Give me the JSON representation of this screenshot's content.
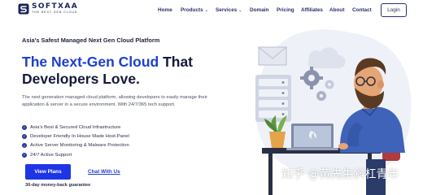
{
  "brand": {
    "name": "SOFTXAA",
    "tagline": "THE NEXT GEN CLOUD",
    "color": "#1b2456"
  },
  "nav": {
    "items": [
      {
        "label": "Home",
        "dropdown": false
      },
      {
        "label": "Products",
        "dropdown": true
      },
      {
        "label": "Services",
        "dropdown": true
      },
      {
        "label": "Domain",
        "dropdown": false
      },
      {
        "label": "Pricing",
        "dropdown": false
      },
      {
        "label": "Affiliates",
        "dropdown": false
      },
      {
        "label": "About",
        "dropdown": false
      },
      {
        "label": "Contact",
        "dropdown": false
      }
    ],
    "login_label": "Login"
  },
  "hero": {
    "eyebrow": "Asia's Safest Managed Next Gen Cloud Platform",
    "headline_accent": "The Next-Gen Cloud",
    "headline_rest_1": " That",
    "headline_line_2": "Developers Love.",
    "description": "The next generation managed cloud platform, allowing developers to easily manage their application & server in a secure environment. With 24/7/365 tech support.",
    "features": [
      "Asia's Best & Secured Cloud Infrastructure",
      "Developer Friendly In House Made Host-Panel",
      "Active Server Monitoring & Malware Protection",
      "24/7 Active Support"
    ],
    "primary_button": "View Plans",
    "secondary_link": "Chat With Us",
    "guarantee": "30-day money-back guarantee"
  },
  "watermark": "知乎 @黄先生斜杠青年",
  "colors": {
    "accent": "#1d3fcf",
    "button": "#1e35e6",
    "navy": "#14193a"
  }
}
